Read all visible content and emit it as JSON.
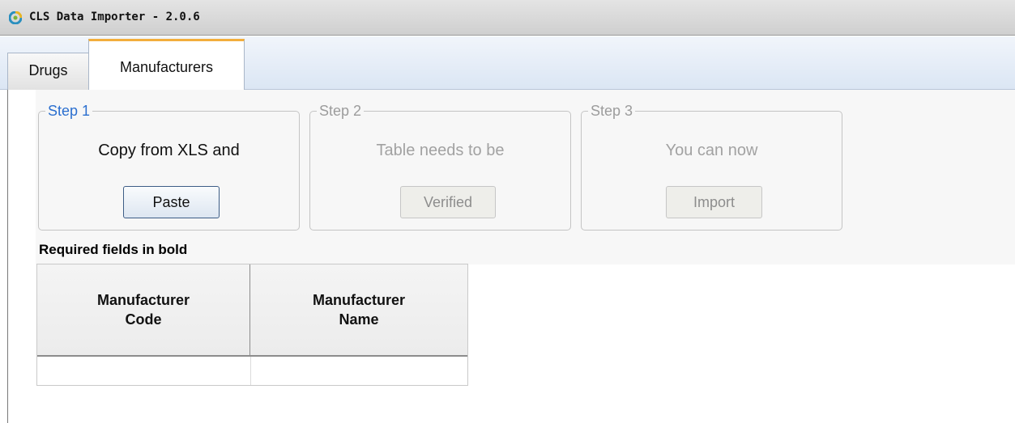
{
  "window": {
    "title": "CLS Data Importer - 2.0.6",
    "icon": "app-logo-icon"
  },
  "tabs": [
    {
      "label": "Drugs",
      "active": false
    },
    {
      "label": "Manufacturers",
      "active": true
    }
  ],
  "steps": [
    {
      "legend": "Step 1",
      "description": "Copy from XLS and",
      "button": "Paste",
      "enabled": true
    },
    {
      "legend": "Step 2",
      "description": "Table needs to be",
      "button": "Verified",
      "enabled": false
    },
    {
      "legend": "Step 3",
      "description": "You can now",
      "button": "Import",
      "enabled": false
    }
  ],
  "grid": {
    "caption": "Required fields in bold",
    "columns": [
      "Manufacturer\nCode",
      "Manufacturer\nName"
    ],
    "rows": [
      [
        "",
        ""
      ]
    ]
  },
  "colors": {
    "active_tab_accent": "#f3ae3c",
    "step_active_legend": "#2b6fcf"
  }
}
